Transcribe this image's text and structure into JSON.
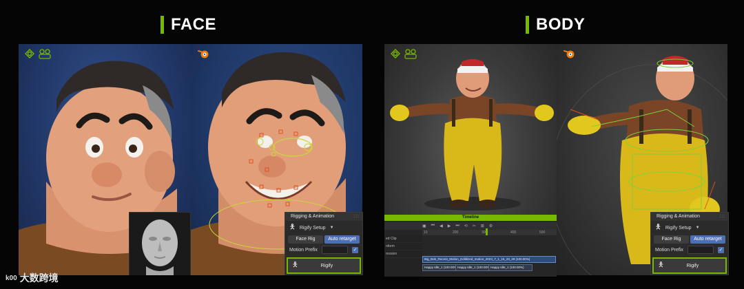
{
  "headings": {
    "face": "FACE",
    "body": "BODY"
  },
  "rig_panel": {
    "title": "Rigging & Animation",
    "setup_label": "Rigify Setup",
    "face_rig": "Face Rig",
    "auto_retarget": "Auto retarget",
    "motion_prefix": "Motion Prefix",
    "rigify": "Rigify"
  },
  "timeline": {
    "title": "Timeline",
    "ruler": [
      "10",
      "200",
      "300",
      "400",
      "500"
    ],
    "tracks": [
      "ed Clip",
      "nform",
      "ression"
    ],
    "clip_main": "Big_Bob_Recent_Motion_Editilized_motion_2024_7_1_15_23_28 (100.00%)",
    "clip_a": "Happy Idle_1 (100.00%)",
    "clip_b": "Happy Idle_1 (100.00%)",
    "clip_c": "Happy Idle_1 (100.00%)"
  },
  "watermark": {
    "logo": "k00",
    "text": "大数跨境"
  },
  "colors": {
    "accent": "#76b900",
    "button_active": "#4d6fb5"
  },
  "icons": [
    "nvidia-icon",
    "characters-icon",
    "blender-icon",
    "figure-icon",
    "chevron-down-icon",
    "check-icon"
  ]
}
